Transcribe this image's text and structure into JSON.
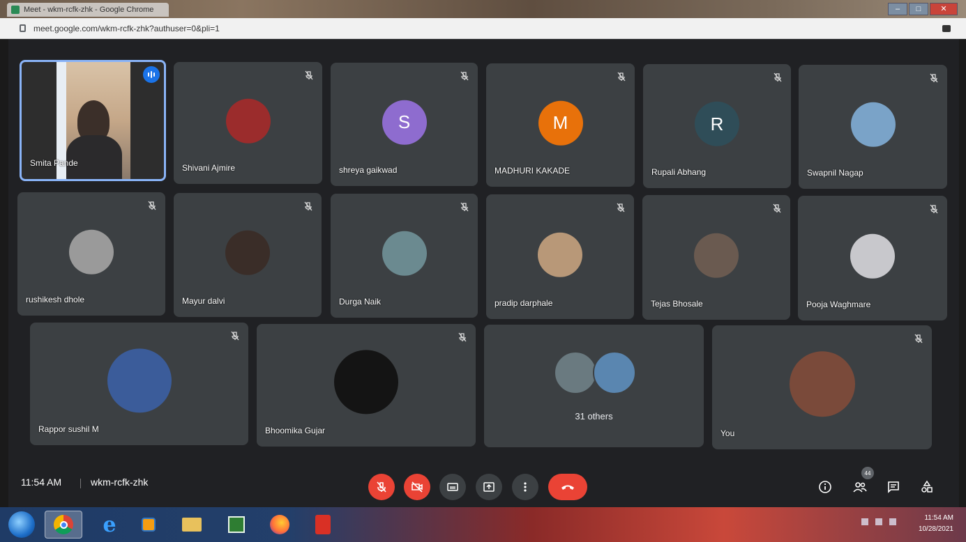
{
  "browser": {
    "tab_title": "Meet - wkm-rcfk-zhk - Google Chrome",
    "url": "meet.google.com/wkm-rcfk-zhk?authuser=0&pli=1",
    "window_buttons": [
      "–",
      "□",
      "✕"
    ]
  },
  "meeting": {
    "time": "11:54 AM",
    "separator": "|",
    "code": "wkm-rcfk-zhk",
    "participant_count": "44"
  },
  "participants": [
    {
      "name": "Smita Pande",
      "kind": "video",
      "speaking": true
    },
    {
      "name": "Shivani Ajmire",
      "kind": "photo",
      "color": "#9b2c2c"
    },
    {
      "name": "shreya gaikwad",
      "kind": "letter",
      "letter": "S",
      "color": "#8e6ccf"
    },
    {
      "name": "MADHURI KAKADE",
      "kind": "letter",
      "letter": "M",
      "color": "#e8710a"
    },
    {
      "name": "Rupali Abhang",
      "kind": "letter",
      "letter": "R",
      "color": "#2f4d58"
    },
    {
      "name": "Swapnil Nagap",
      "kind": "photo",
      "color": "#7aa3c8"
    },
    {
      "name": "rushikesh dhole",
      "kind": "photo",
      "color": "#9a9a9a"
    },
    {
      "name": "Mayur dalvi",
      "kind": "photo",
      "color": "#3a2d28"
    },
    {
      "name": "Durga Naik",
      "kind": "photo",
      "color": "#6b8a90"
    },
    {
      "name": "pradip darphale",
      "kind": "photo",
      "color": "#b89878"
    },
    {
      "name": "Tejas Bhosale",
      "kind": "photo",
      "color": "#6a5a50"
    },
    {
      "name": "Pooja Waghmare",
      "kind": "photo",
      "color": "#c8c8cc"
    },
    {
      "name": "Rappor sushil M",
      "kind": "photo",
      "color": "#3b5c9a"
    },
    {
      "name": "Bhoomika Gujar",
      "kind": "photo",
      "color": "#141414"
    },
    {
      "name": "31 others",
      "kind": "group",
      "color": "#6a7a80"
    },
    {
      "name": "You",
      "kind": "photo",
      "color": "#7a4a3a"
    }
  ],
  "controls": {
    "mic": "mic-off-icon",
    "camera": "camera-off-icon",
    "captions": "captions-icon",
    "present": "present-icon",
    "more": "more-vert-icon",
    "leave": "call-end-icon",
    "info": "info-icon",
    "people": "people-icon",
    "chat": "chat-icon",
    "activities": "activities-icon"
  },
  "taskbar": {
    "time": "11:54 AM",
    "date": "10/28/2021"
  },
  "colors": {
    "meet_bg": "#202124",
    "tile_bg": "#3c4043",
    "active_border": "#8ab4f8",
    "red_button": "#ea4335"
  }
}
